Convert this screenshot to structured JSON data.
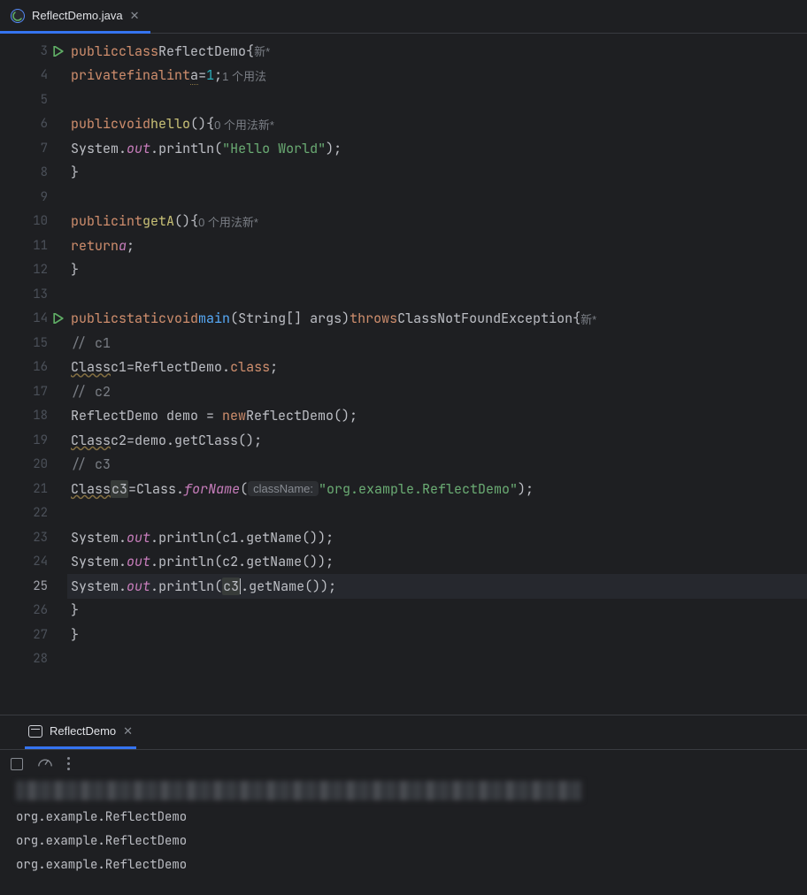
{
  "tab": {
    "filename": "ReflectDemo.java"
  },
  "lines": [
    "3",
    "4",
    "5",
    "6",
    "7",
    "8",
    "9",
    "10",
    "11",
    "12",
    "13",
    "14",
    "15",
    "16",
    "17",
    "18",
    "19",
    "20",
    "21",
    "22",
    "23",
    "24",
    "25",
    "26",
    "27",
    "28"
  ],
  "runIconLines": [
    "3",
    "14"
  ],
  "hints": {
    "new": "新*",
    "usage0": "0 个用法",
    "usage1": "1 个用法",
    "className": "className:"
  },
  "code": {
    "l3": {
      "kw_public": "public",
      "kw_class": "class",
      "name": "ReflectDemo",
      "brace": "{"
    },
    "l4": {
      "kw_private": "private",
      "kw_final": "final",
      "kw_int": "int",
      "var": "a",
      "eq": "=",
      "num": "1",
      "semi": ";"
    },
    "l6": {
      "kw_public": "public",
      "kw_void": "void",
      "fn": "hello",
      "parens": "()",
      "brace": "{"
    },
    "l7": {
      "sys": "System",
      "dot1": ".",
      "out": "out",
      "dot2": ".",
      "println": "println",
      "open": "(",
      "str": "\"Hello World\"",
      "close": ");"
    },
    "l8": {
      "brace": "}"
    },
    "l10": {
      "kw_public": "public",
      "kw_int": "int",
      "fn": "getA",
      "parens": "()",
      "brace": "{"
    },
    "l11": {
      "kw_return": "return",
      "var": "a",
      "semi": ";"
    },
    "l12": {
      "brace": "}"
    },
    "l14": {
      "kw_public": "public",
      "kw_static": "static",
      "kw_void": "void",
      "fn": "main",
      "sig": "(String[] args)",
      "kw_throws": "throws",
      "exc": "ClassNotFoundException",
      "brace": "{"
    },
    "l15": {
      "c": "// c1"
    },
    "l16": {
      "cls": "Class",
      "var": "c1",
      "eq": "=",
      "rhs": "ReflectDemo.",
      "kw_class": "class",
      "semi": ";"
    },
    "l17": {
      "c": "// c2"
    },
    "l18": {
      "lhs": "ReflectDemo demo = ",
      "kw_new": "new",
      "ctor": "ReflectDemo()",
      "semi": ";"
    },
    "l19": {
      "cls": "Class",
      "var": "c2",
      "eq": "=",
      "rhs": "demo.getClass()",
      "semi": ";"
    },
    "l20": {
      "c": "// c3"
    },
    "l21": {
      "cls": "Class",
      "var": "c3",
      "eq": "=",
      "rhs1": "Class.",
      "forName": "forName",
      "open": "(",
      "str": "\"org.example.ReflectDemo\"",
      "close": ");"
    },
    "l23": {
      "sys": "System",
      "out": "out",
      "println": "println",
      "arg": "(c1.getName());"
    },
    "l24": {
      "sys": "System",
      "out": "out",
      "println": "println",
      "arg": "(c2.getName());"
    },
    "l25": {
      "sys": "System",
      "out": "out",
      "println": "println",
      "open": "(",
      "c3": "c3",
      "rest": ".getName());"
    },
    "l26": {
      "brace": "}"
    },
    "l27": {
      "brace": "}"
    }
  },
  "console": {
    "tabName": "ReflectDemo",
    "output": [
      "org.example.ReflectDemo",
      "org.example.ReflectDemo",
      "org.example.ReflectDemo"
    ]
  }
}
